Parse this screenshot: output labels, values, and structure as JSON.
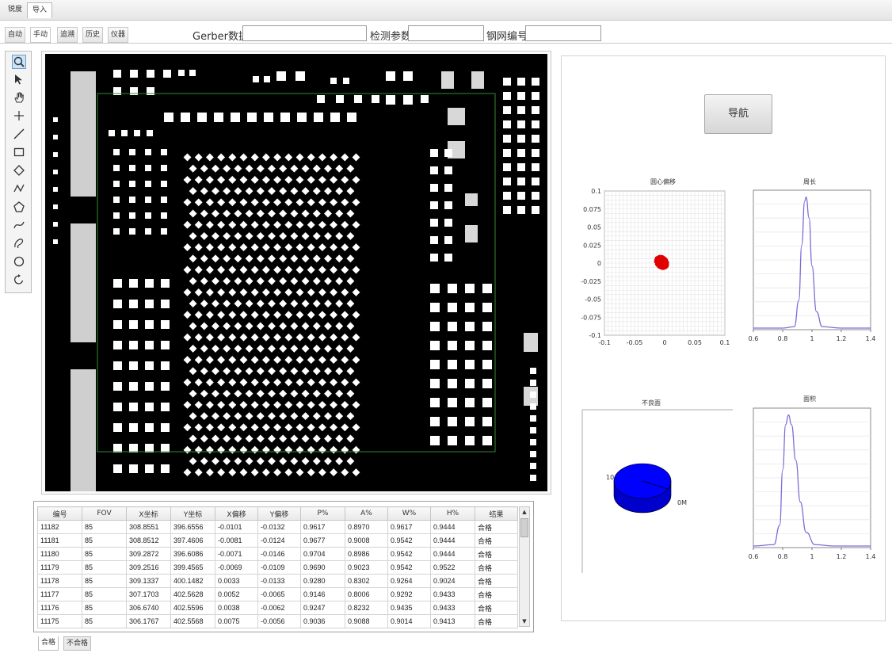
{
  "menu": {
    "tabs": [
      {
        "label": "锐度"
      },
      {
        "label": "导入"
      }
    ]
  },
  "toolbar": {
    "tabs": [
      {
        "label": "自动"
      },
      {
        "label": "手动"
      },
      {
        "label": "追溯"
      },
      {
        "label": "历史"
      },
      {
        "label": "仪器"
      }
    ],
    "gerber_label": "Gerber数据",
    "gerber_value": "",
    "inspect_label": "检测参数",
    "inspect_value": "",
    "stencil_label": "钢网编号",
    "stencil_value": ""
  },
  "tools": [
    "zoom-icon",
    "pointer-arrow-icon",
    "hand-icon",
    "crosshair-icon",
    "line-icon",
    "rectangle-icon",
    "diamond-icon",
    "polyline-icon",
    "polygon-icon",
    "curve-icon",
    "freehand-icon",
    "circle-icon",
    "rotate-icon"
  ],
  "right_panel": {
    "nav_button": "导航"
  },
  "charts": {
    "scatter_title": "圆心偏移",
    "length_title": "周长",
    "pie_title": "不良面",
    "area_title": "面积"
  },
  "chart_data": [
    {
      "type": "scatter",
      "title": "圆心偏移",
      "xlabel": "",
      "ylabel": "",
      "xlim": [
        -0.1,
        0.1
      ],
      "ylim": [
        -0.1,
        0.1
      ],
      "xticks": [
        "-0.1",
        "-0.05",
        "0",
        "0.05",
        "0.1"
      ],
      "yticks": [
        "0.1",
        "0.075",
        "0.05",
        "0.025",
        "0",
        "-0.025",
        "-0.05",
        "-0.075",
        "-0.1"
      ],
      "cluster_center": [
        -0.005,
        0.001
      ],
      "cluster_spread": [
        0.012,
        0.009
      ],
      "color": "#e00000",
      "grid": true
    },
    {
      "type": "line",
      "title": "周长",
      "xlabel": "",
      "ylabel": "",
      "xlim": [
        0.6,
        1.4
      ],
      "xticks": [
        "0.6",
        "0.8",
        "1",
        "1.2",
        "1.4"
      ],
      "ylim": [
        0,
        1
      ],
      "x": [
        0.6,
        0.8,
        0.88,
        0.91,
        0.93,
        0.95,
        0.96,
        0.98,
        1.0,
        1.03,
        1.07,
        1.2,
        1.4
      ],
      "y": [
        0.0,
        0.0,
        0.01,
        0.2,
        0.6,
        0.92,
        0.95,
        0.8,
        0.45,
        0.12,
        0.01,
        0.0,
        0.0
      ],
      "color": "#7b6fd6",
      "grid": true
    },
    {
      "type": "pie",
      "title": "不良面",
      "labels": [
        "0M",
        "10"
      ],
      "values": [
        99,
        1
      ],
      "colors": [
        "#0000ff",
        "#0000cc"
      ]
    },
    {
      "type": "line",
      "title": "面积",
      "xlabel": "",
      "ylabel": "",
      "xlim": [
        0.6,
        1.4
      ],
      "xticks": [
        "0.6",
        "0.8",
        "1",
        "1.2",
        "1.4"
      ],
      "ylim": [
        0,
        1
      ],
      "x": [
        0.6,
        0.74,
        0.78,
        0.8,
        0.82,
        0.84,
        0.86,
        0.89,
        0.92,
        0.96,
        1.02,
        1.15,
        1.4
      ],
      "y": [
        0.0,
        0.01,
        0.15,
        0.55,
        0.88,
        0.95,
        0.88,
        0.62,
        0.32,
        0.1,
        0.01,
        0.0,
        0.0
      ],
      "color": "#7b6fd6",
      "grid": true
    }
  ],
  "table": {
    "headers": [
      "编号",
      "FOV",
      "X坐标",
      "Y坐标",
      "X偏移",
      "Y偏移",
      "P%",
      "A%",
      "W%",
      "H%",
      "结果"
    ],
    "rows": [
      [
        "11182",
        "85",
        "308.8551",
        "396.6556",
        "-0.0101",
        "-0.0132",
        "0.9617",
        "0.8970",
        "0.9617",
        "0.9444",
        "合格"
      ],
      [
        "11181",
        "85",
        "308.8512",
        "397.4606",
        "-0.0081",
        "-0.0124",
        "0.9677",
        "0.9008",
        "0.9542",
        "0.9444",
        "合格"
      ],
      [
        "11180",
        "85",
        "309.2872",
        "396.6086",
        "-0.0071",
        "-0.0146",
        "0.9704",
        "0.8986",
        "0.9542",
        "0.9444",
        "合格"
      ],
      [
        "11179",
        "85",
        "309.2516",
        "399.4565",
        "-0.0069",
        "-0.0109",
        "0.9690",
        "0.9023",
        "0.9542",
        "0.9522",
        "合格"
      ],
      [
        "11178",
        "85",
        "309.1337",
        "400.1482",
        "0.0033",
        "-0.0133",
        "0.9280",
        "0.8302",
        "0.9264",
        "0.9024",
        "合格"
      ],
      [
        "11177",
        "85",
        "307.1703",
        "402.5628",
        "0.0052",
        "-0.0065",
        "0.9146",
        "0.8006",
        "0.9292",
        "0.9433",
        "合格"
      ],
      [
        "11176",
        "85",
        "306.6740",
        "402.5596",
        "0.0038",
        "-0.0062",
        "0.9247",
        "0.8232",
        "0.9435",
        "0.9433",
        "合格"
      ],
      [
        "11175",
        "85",
        "306.1767",
        "402.5568",
        "0.0075",
        "-0.0056",
        "0.9036",
        "0.9088",
        "0.9014",
        "0.9413",
        "合格"
      ]
    ]
  },
  "bottom_tabs": [
    {
      "label": "合格"
    },
    {
      "label": "不合格"
    }
  ],
  "colors": {
    "pcb_background": "#000000",
    "pad": "#ffffff",
    "inspect_frame": "#2e8b2e",
    "scatter": "#e00000",
    "curve": "#7b6fd6"
  }
}
